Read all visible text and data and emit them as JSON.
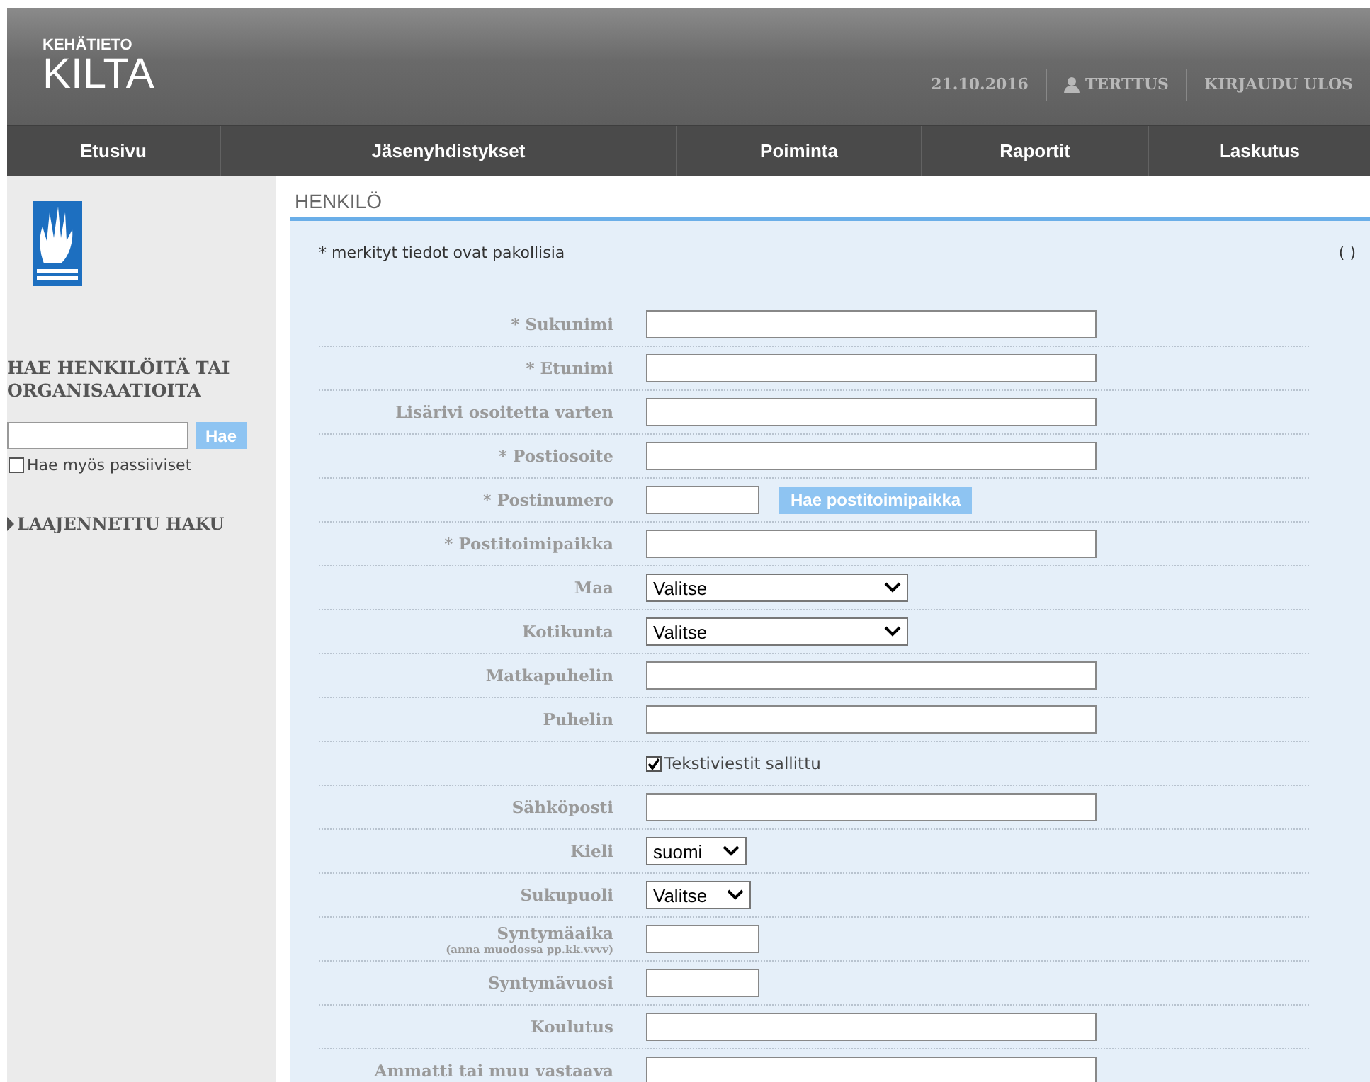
{
  "header": {
    "brand_small": "KEHÄTIETO",
    "brand": "KILTA",
    "date": "21.10.2016",
    "user": "TERTTUS",
    "logout": "KIRJAUDU ULOS"
  },
  "nav": [
    {
      "label": "Etusivu",
      "selected": false
    },
    {
      "label": "Jäsenyhdistykset",
      "selected": false
    },
    {
      "label": "Poiminta",
      "selected": false
    },
    {
      "label": "Raportit",
      "selected": false
    },
    {
      "label": "Laskutus",
      "selected": false
    }
  ],
  "sidebar": {
    "search_title": "HAE HENKILÖITÄ TAI ORGANISAATIOITA",
    "search_button": "Hae",
    "passive": {
      "label": "Hae myös passiiviset",
      "checked": false
    },
    "advanced": "LAAJENNETTU HAKU"
  },
  "section_title": "HENKILÖ",
  "required_note": "* merkityt tiedot ovat pakollisia",
  "corner": "( )",
  "fields": [
    {
      "kind": "text",
      "label": "* Sukunimi"
    },
    {
      "kind": "text",
      "label": "* Etunimi"
    },
    {
      "kind": "text",
      "label": "Lisärivi osoitetta varten"
    },
    {
      "kind": "text",
      "label": "* Postiosoite"
    },
    {
      "kind": "short",
      "label": "* Postinumero",
      "button": "Hae postitoimipaikka"
    },
    {
      "kind": "text",
      "label": "* Postitoimipaikka"
    },
    {
      "kind": "select",
      "label": "Maa",
      "value": "Valitse"
    },
    {
      "kind": "select",
      "label": "Kotikunta",
      "value": "Valitse"
    },
    {
      "kind": "text",
      "label": "Matkapuhelin"
    },
    {
      "kind": "text",
      "label": "Puhelin"
    },
    {
      "kind": "checkbox",
      "label": "Tekstiviestit sallittu",
      "checked": true
    },
    {
      "kind": "text",
      "label": "Sähköposti"
    },
    {
      "kind": "select",
      "label": "Kieli",
      "value": "suomi"
    },
    {
      "kind": "select",
      "label": "Sukupuoli",
      "value": "Valitse"
    },
    {
      "kind": "short",
      "label": "Syntymäaika",
      "hint": "(anna muodossa pp.kk.vvvv)"
    },
    {
      "kind": "short",
      "label": "Syntymävuosi"
    },
    {
      "kind": "text",
      "label": "Koulutus"
    },
    {
      "kind": "text",
      "label": "Ammatti tai muu vastaava"
    }
  ]
}
